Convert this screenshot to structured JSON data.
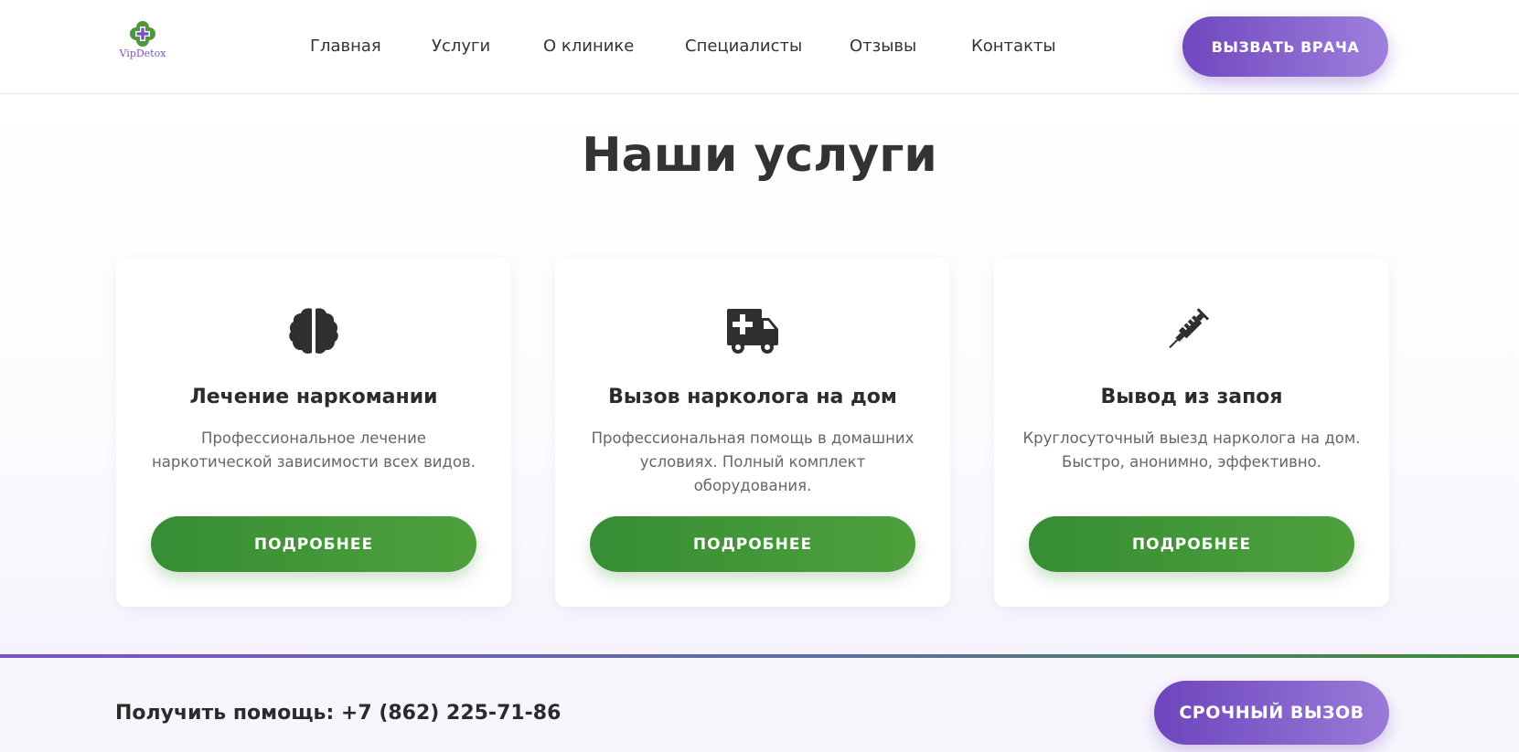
{
  "header": {
    "logo_text": "VipDetox",
    "nav": [
      {
        "label": "Главная",
        "icon": null
      },
      {
        "label": "Услуги"
      },
      {
        "label": "О клинике"
      },
      {
        "label": "Специалисты"
      },
      {
        "label": "Отзывы"
      },
      {
        "label": "Контакты"
      }
    ],
    "call_button": "ВЫЗВАТЬ ВРАЧА"
  },
  "services": {
    "title": "Наши услуги",
    "cards": [
      {
        "icon": "brain-icon",
        "title": "Лечение наркомании",
        "description": "Профессиональное лечение наркотической зависимости всех видов.",
        "button": "ПОДРОБНЕЕ"
      },
      {
        "icon": "ambulance-icon",
        "title": "Вызов нарколога на дом",
        "description": "Профессиональная помощь в домашних условиях. Полный комплект оборудования.",
        "button": "ПОДРОБНЕЕ"
      },
      {
        "icon": "syringe-icon",
        "title": "Вывод из запоя",
        "description": "Круглосуточный выезд нарколога на дом. Быстро, анонимно, эффективно.",
        "button": "ПОДРОБНЕЕ"
      }
    ]
  },
  "bottom_bar": {
    "text": "Получить помощь: +7 (862) 225-71-86",
    "urgent_button": "СРОЧНЫЙ ВЫЗОВ"
  },
  "colors": {
    "accent_purple": "#7a52c4",
    "accent_green": "#3e9436",
    "text_dark": "#333333",
    "text_muted": "#666666"
  }
}
